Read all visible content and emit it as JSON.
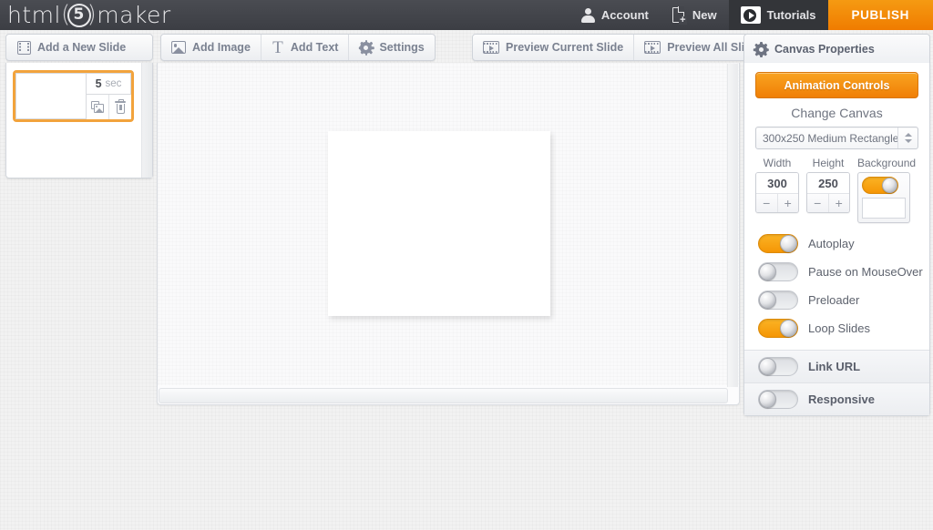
{
  "header": {
    "logo": {
      "prefix": "html",
      "badge": "5",
      "suffix": "maker"
    },
    "items": [
      {
        "label": "Account",
        "icon": "person-icon"
      },
      {
        "label": "New",
        "icon": "new-document-icon"
      },
      {
        "label": "Tutorials",
        "icon": "play-video-icon"
      },
      {
        "label": "PUBLISH",
        "icon": "publish"
      }
    ]
  },
  "toolbar": {
    "add_slide": "Add a New Slide",
    "add_image": "Add Image",
    "add_text": "Add Text",
    "settings": "Settings",
    "preview_current": "Preview Current Slide",
    "preview_all": "Preview All Slides",
    "canvas_properties": "Canvas Properties"
  },
  "slides": [
    {
      "duration_value": "5",
      "duration_unit": "sec"
    }
  ],
  "panel": {
    "animation_controls": "Animation Controls",
    "change_canvas": "Change Canvas",
    "canvas_preset": "300x250 Medium Rectangle",
    "width_label": "Width",
    "width_value": "300",
    "height_label": "Height",
    "height_value": "250",
    "background_label": "Background",
    "minus": "−",
    "plus": "+",
    "toggles": [
      {
        "label": "Autoplay",
        "state": "on"
      },
      {
        "label": "Pause on MouseOver",
        "state": "off"
      },
      {
        "label": "Preloader",
        "state": "off"
      },
      {
        "label": "Loop Slides",
        "state": "on"
      }
    ],
    "bands": [
      {
        "label": "Link URL",
        "state": "off"
      },
      {
        "label": "Responsive",
        "state": "off"
      }
    ]
  },
  "colors": {
    "accent_orange": "#f59605",
    "header_dark": "#44464c",
    "slide_selected_border": "#f2a33c",
    "canvas_background": "#ffffff"
  }
}
